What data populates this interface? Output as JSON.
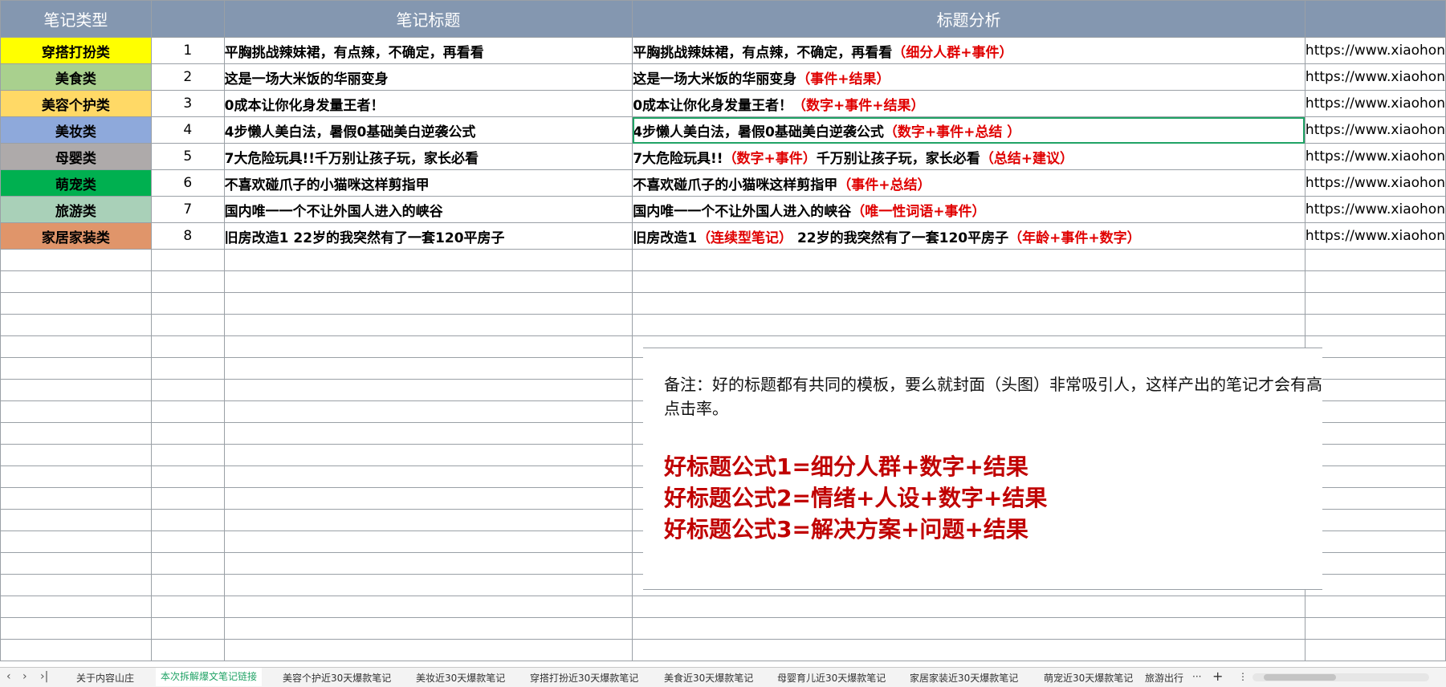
{
  "headers": {
    "type": "笔记类型",
    "title": "笔记标题",
    "analysis": "标题分析"
  },
  "rows": [
    {
      "type": "穿搭打扮类",
      "bg": "#ffff00",
      "num": "1",
      "title": "平胸挑战辣妹裙，有点辣，不确定，再看看",
      "a1": "平胸挑战辣妹裙，有点辣，不确定，再看看",
      "r1": "（细分人群+事件）",
      "a2": "",
      "r2": "",
      "url": "https://www.xiaohon"
    },
    {
      "type": "美食类",
      "bg": "#a9d08e",
      "num": "2",
      "title": "这是一场大米饭的华丽变身",
      "a1": "这是一场大米饭的华丽变身",
      "r1": "（事件+结果）",
      "a2": "",
      "r2": "",
      "url": "https://www.xiaohon"
    },
    {
      "type": "美容个护类",
      "bg": "#ffd966",
      "num": "3",
      "title": "0成本让你化身发量王者！",
      "a1": "0成本让你化身发量王者！",
      "r1": "（数字+事件+结果）",
      "a2": "",
      "r2": "",
      "url": "https://www.xiaohon"
    },
    {
      "type": "美妆类",
      "bg": "#8ea9db",
      "num": "4",
      "title": "4步懒人美白法，暑假0基础美白逆袭公式",
      "a1": "4步懒人美白法，暑假0基础美白逆袭公式",
      "r1": "（数字+事件+总结 ）",
      "a2": "",
      "r2": "",
      "url": "https://www.xiaohon"
    },
    {
      "type": "母婴类",
      "bg": "#aeaaaa",
      "num": "5",
      "title": "7大危险玩具!!千万别让孩子玩，家长必看",
      "a1": "7大危险玩具!!",
      "r1": "（数字+事件）",
      "a2": "千万别让孩子玩，家长必看",
      "r2": "（总结+建议）",
      "url": "https://www.xiaohon"
    },
    {
      "type": "萌宠类",
      "bg": "#00b050",
      "num": "6",
      "title": "不喜欢碰爪子的小猫咪这样剪指甲",
      "a1": "不喜欢碰爪子的小猫咪这样剪指甲",
      "r1": "（事件+总结）",
      "a2": "",
      "r2": "",
      "url": "https://www.xiaohon"
    },
    {
      "type": "旅游类",
      "bg": "#a9d0b8",
      "num": "7",
      "title": "国内唯一一个不让外国人进入的峡谷",
      "a1": "国内唯一一个不让外国人进入的峡谷",
      "r1": "（唯一性词语+事件）",
      "a2": "",
      "r2": "",
      "url": "https://www.xiaohon"
    },
    {
      "type": "家居家装类",
      "bg": "#e0956a",
      "num": "8",
      "title": "旧房改造1     22岁的我突然有了一套120平房子",
      "a1": "旧房改造1",
      "r1": "（连续型笔记）",
      "a2": "     22岁的我突然有了一套120平房子",
      "r2": "（年龄+事件+数字）",
      "url": "https://www.xiaohon"
    }
  ],
  "note": {
    "text": "备注：好的标题都有共同的模板，要么就封面（头图）非常吸引人，这样产出的笔记才会有高点击率。",
    "formula1": "好标题公式1=细分人群+数字+结果",
    "formula2": "好标题公式2=情绪+人设+数字+结果",
    "formula3": "好标题公式3=解决方案+问题+结果"
  },
  "tabs": [
    "关于内容山庄",
    "本次拆解爆文笔记链接",
    "美容个护近30天爆款笔记",
    "美妆近30天爆款笔记",
    "穿搭打扮近30天爆款笔记",
    "美食近30天爆款笔记",
    "母婴育儿近30天爆款笔记",
    "家居家装近30天爆款笔记",
    "萌宠近30天爆款笔记",
    "旅游出行"
  ],
  "active_tab": "本次拆解爆文笔记链接",
  "tab_more": "···",
  "add_sheet": "+",
  "colors": {
    "header": "#8497b0",
    "accent_red": "#e00000",
    "selection": "#21a366",
    "formula_red": "#c00000"
  }
}
